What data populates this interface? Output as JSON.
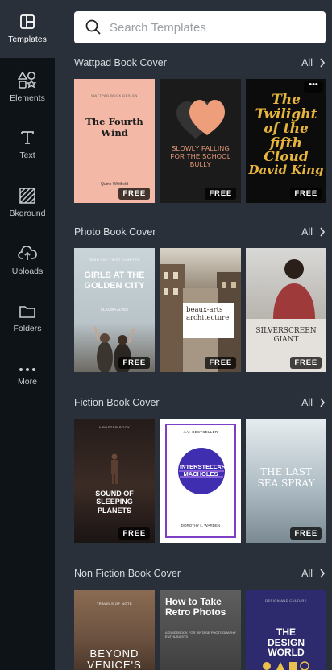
{
  "sidebar": {
    "items": [
      {
        "label": "Templates",
        "icon": "templates-icon"
      },
      {
        "label": "Elements",
        "icon": "elements-icon"
      },
      {
        "label": "Text",
        "icon": "text-icon"
      },
      {
        "label": "Bkground",
        "icon": "background-icon"
      },
      {
        "label": "Uploads",
        "icon": "uploads-icon"
      },
      {
        "label": "Folders",
        "icon": "folders-icon"
      },
      {
        "label": "More",
        "icon": "more-icon"
      }
    ]
  },
  "search": {
    "placeholder": "Search Templates"
  },
  "sections": [
    {
      "title": "Wattpad Book Cover",
      "all_label": "All",
      "cards": [
        {
          "badge": "FREE",
          "kicker": "WATTPAD BOOK DESIGN",
          "title": "The Fourth Wind",
          "author": "Quinn Whitfield",
          "colors": {
            "bg": "#f4b9a6",
            "text": "#1e1e1e"
          }
        },
        {
          "badge": "FREE",
          "title": "SLOWLY FALLING FOR THE SCHOOL BULLY",
          "colors": {
            "bg": "#1b1b1b",
            "heart": "#ee9e7a",
            "heart2": "#333333",
            "text": "#ee9e7a"
          }
        },
        {
          "badge": "FREE",
          "title": "The Twilight of the fifth Cloud",
          "author": "David King",
          "more": "•••",
          "colors": {
            "bg": "#0c0c0c",
            "text": "#e7b53d"
          }
        }
      ]
    },
    {
      "title": "Photo Book Cover",
      "all_label": "All",
      "cards": [
        {
          "badge": "FREE",
          "kicker": "READ THE FIRST CHAPTER",
          "title": "GIRLS AT THE GOLDEN CITY",
          "author": "CLAUDIA ALVES",
          "colors": {
            "bg": "#bcc9ce",
            "text": "#ffffff"
          }
        },
        {
          "badge": "FREE",
          "title": "beaux-arts architecture",
          "colors": {
            "bg": "#8a7c6a",
            "text": "#3a2f27"
          }
        },
        {
          "badge": "FREE",
          "title": "SILVERSCREEN GIANT",
          "colors": {
            "bg": "#e4e0dc",
            "text": "#333333"
          }
        }
      ]
    },
    {
      "title": "Fiction Book Cover",
      "all_label": "All",
      "cards": [
        {
          "badge": "FREE",
          "kicker": "A POSTER BOOK",
          "title": "SOUND OF SLEEPING PLANETS",
          "colors": {
            "bg": "#3b2b25",
            "text": "#ffffff"
          }
        },
        {
          "kicker": "A.V. BESTSELLER",
          "title": "INTERSTELLAR MACHOLES",
          "author": "DOROTHY L. WARDEN",
          "colors": {
            "bg": "#ffffff",
            "frame": "#7e3fc4",
            "planet": "#3f2fb0",
            "text": "#ffffff"
          }
        },
        {
          "badge": "FREE",
          "title": "THE LAST SEA SPRAY",
          "colors": {
            "bg": "#c9d4da",
            "text": "#ffffff"
          }
        }
      ]
    },
    {
      "title": "Non Fiction Book Cover",
      "all_label": "All",
      "cards": [
        {
          "title": "BEYOND VENICE'S",
          "kicker": "TRAVELS OF NOTE",
          "colors": {
            "bg": "#6c5240",
            "text": "#ffffff"
          }
        },
        {
          "title": "How to Take Retro Photos",
          "kicker": "A GUIDEBOOK FOR VINTAGE PHOTOGRAPHY ENTHUSIASTS",
          "colors": {
            "bg": "#4d4d4d",
            "text": "#ffffff"
          }
        },
        {
          "title": "THE DESIGN WORLD",
          "kicker": "DESIGN AND CULTURE",
          "colors": {
            "bg": "#2e2a6e",
            "text": "#ffffff"
          }
        }
      ]
    }
  ],
  "colors": {
    "sidebar_bg": "#0e1318",
    "panel_bg": "#293039",
    "accent": "#ffffff"
  }
}
